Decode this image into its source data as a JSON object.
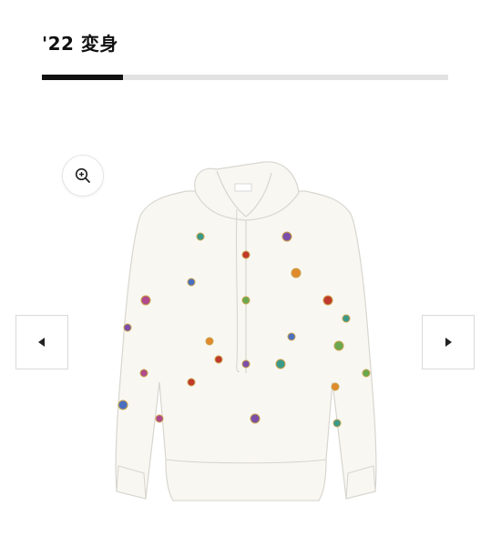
{
  "header": {
    "title": "'22 変身"
  },
  "gallery": {
    "progress": 0.2,
    "zoom_icon": "zoom-in-icon",
    "prev_icon": "left-triangle-icon",
    "next_icon": "right-triangle-icon",
    "product_colors": {
      "garment": "#f8f7f2",
      "outline": "#d8d6cf",
      "shadow": "#e9e7e0"
    },
    "gem_colors": [
      "#7b4fa8",
      "#3a9a8a",
      "#c0392b",
      "#e08a2c",
      "#4a6fc0",
      "#6aa84f",
      "#b04a8c"
    ]
  }
}
